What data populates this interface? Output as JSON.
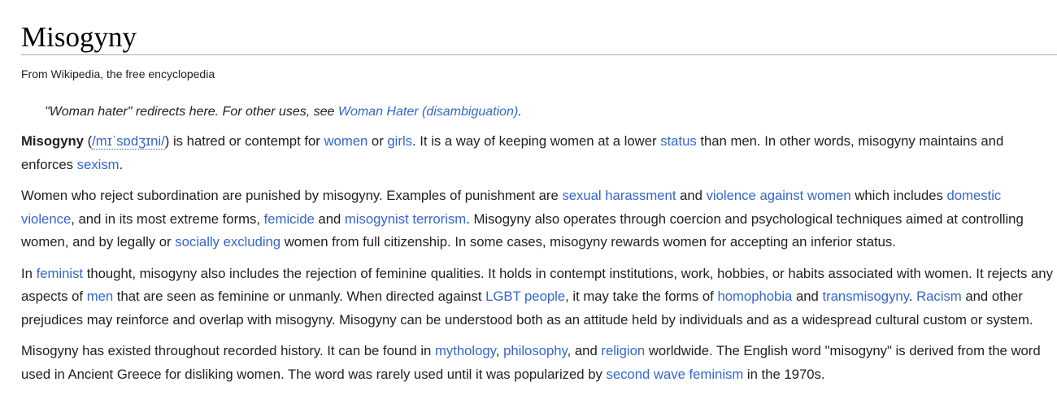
{
  "title": "Misogyny",
  "tagline": "From Wikipedia, the free encyclopedia",
  "hatnote": {
    "text": "\"Woman hater\" redirects here. For other uses, see ",
    "link": "Woman Hater (disambiguation)",
    "end": "."
  },
  "p1": {
    "bold": "Misogyny",
    "open": " (",
    "ipa": "/mɪˈsɒdʒɪni/",
    "t1": ") is hatred or contempt for ",
    "l1": "women",
    "t2": " or ",
    "l2": "girls",
    "t3": ". It is a way of keeping women at a lower ",
    "l3": "status",
    "t4": " than men. In other words, misogyny maintains and enforces ",
    "l4": "sexism",
    "t5": "."
  },
  "p2": {
    "t1": "Women who reject subordination are punished by misogyny. Examples of punishment are ",
    "l1": "sexual harassment",
    "t2": " and ",
    "l2": "violence against women",
    "t3": " which includes ",
    "l3": "domestic violence",
    "t4": ", and in its most extreme forms, ",
    "l4": "femicide",
    "t5": " and ",
    "l5": "misogynist terrorism",
    "t6": ". Misogyny also operates through coercion and psychological techniques aimed at controlling women, and by legally or ",
    "l6": "socially excluding",
    "t7": " women from full citizenship. In some cases, misogyny rewards women for accepting an inferior status."
  },
  "p3": {
    "t1": "In ",
    "l1": "feminist",
    "t2": " thought, misogyny also includes the rejection of feminine qualities. It holds in contempt institutions, work, hobbies, or habits associated with women. It rejects any aspects of ",
    "l2": "men",
    "t3": " that are seen as feminine or unmanly. When directed against ",
    "l3": "LGBT people",
    "t4": ", it may take the forms of ",
    "l4": "homophobia",
    "t5": " and ",
    "l5": "transmisogyny",
    "t6": ". ",
    "l6": "Racism",
    "t7": " and other prejudices may reinforce and overlap with misogyny. Misogyny can be understood both as an attitude held by individuals and as a widespread cultural custom or system."
  },
  "p4": {
    "t1": "Misogyny has existed throughout recorded history. It can be found in ",
    "l1": "mythology",
    "t2": ", ",
    "l2": "philosophy",
    "t3": ", and ",
    "l3": "religion",
    "t4": " worldwide. The English word \"misogyny\" is derived from the word used in Ancient Greece for disliking women. The word was rarely used until it was popularized by ",
    "l4": "second wave feminism",
    "t5": " in the 1970s."
  },
  "colors": {
    "link": "#3366cc",
    "text": "#202122",
    "rule": "#a2a9b1"
  }
}
